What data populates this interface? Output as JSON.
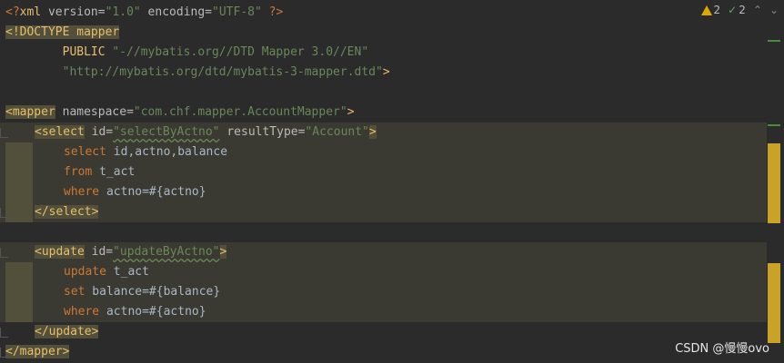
{
  "inspector": {
    "warnings": "2",
    "weak_warnings": "2",
    "colors": {
      "warning": "#e0a800",
      "ok": "#5faa58"
    }
  },
  "code": {
    "l1": {
      "open": "<?",
      "name": "xml",
      "a1": " version=",
      "v1": "\"1.0\"",
      "a2": " encoding=",
      "v2": "\"UTF-8\"",
      "close": " ?>"
    },
    "l2": {
      "text": "<!DOCTYPE mapper"
    },
    "l3": {
      "indent": "        PUBLIC ",
      "val": "\"-//mybatis.org//DTD Mapper 3.0//EN\""
    },
    "l4": {
      "indent": "        ",
      "val": "\"http://mybatis.org/dtd/mybatis-3-mapper.dtd\"",
      "close": ">"
    },
    "l6": {
      "open": "<mapper",
      "attr": " namespace=",
      "val": "\"com.chf.mapper.AccountMapper\"",
      "close": ">"
    },
    "l7": {
      "open": "<select",
      "a1": " id=",
      "v1": "\"selectByActno\"",
      "a2": " resultType=",
      "v2": "\"Account\"",
      "close": ">"
    },
    "l8": {
      "kw": "select",
      "rest": " id,actno,balance"
    },
    "l9": {
      "kw": "from",
      "rest": " t_act"
    },
    "l10": {
      "kw": "where",
      "rest1": " actno",
      "rest2": "=#{actno}"
    },
    "l11": {
      "text": "</select>"
    },
    "l13": {
      "open": "<update",
      "attr": " id=",
      "val": "\"updateByActno\"",
      "close": ">"
    },
    "l14": {
      "kw": "update",
      "rest": " t_act"
    },
    "l15": {
      "kw": "set",
      "rest": " balance=#{balance}"
    },
    "l16": {
      "kw": "where",
      "rest1": " actno",
      "rest2": "=#{actno}"
    },
    "l17": {
      "text": "</update>"
    },
    "l18": {
      "text": "</mapper>"
    }
  },
  "watermark": "CSDN @慢慢ovo"
}
